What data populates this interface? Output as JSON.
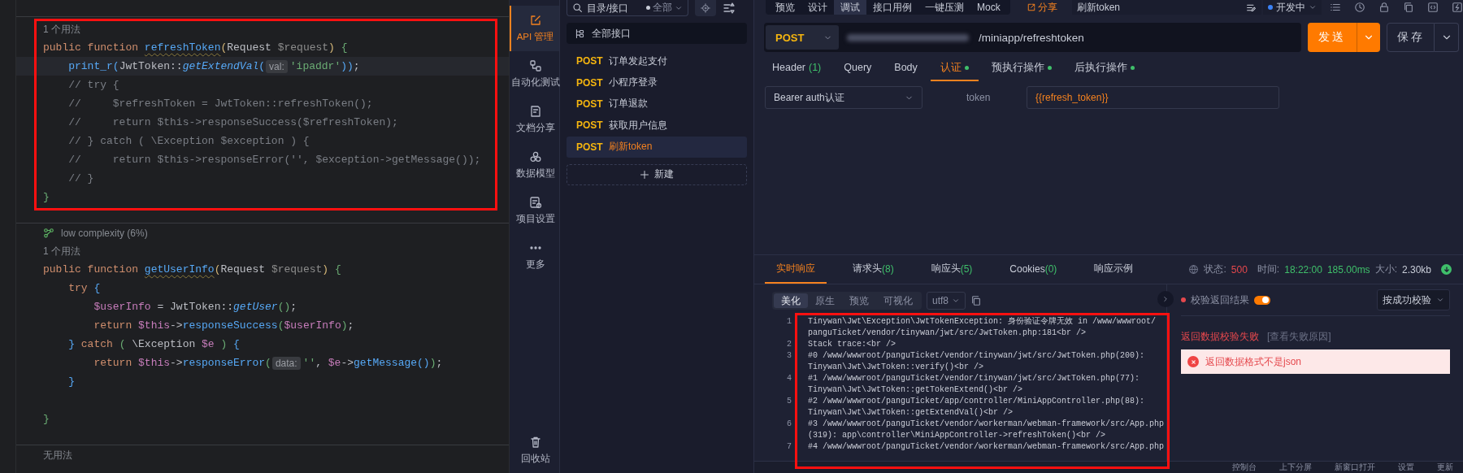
{
  "editor": {
    "highlighted": true,
    "blocks": [
      {
        "usage": "1 个用法",
        "lines": [
          {
            "kind": "code",
            "current": false,
            "tokens": [
              {
                "kind": "kw",
                "text": "public function "
              },
              {
                "kind": "fndef",
                "text": "refreshToken"
              },
              {
                "kind": "paren1",
                "text": "("
              },
              {
                "kind": "plain",
                "text": "Request "
              },
              {
                "kind": "param",
                "text": "$request"
              },
              {
                "kind": "paren1",
                "text": ") "
              },
              {
                "kind": "paren2",
                "text": "{"
              }
            ]
          },
          {
            "kind": "code",
            "current": true,
            "tokens": [
              {
                "kind": "call",
                "text": "    print_r"
              },
              {
                "kind": "paren3",
                "text": "("
              },
              {
                "kind": "plain",
                "text": "JwtToken::"
              },
              {
                "kind": "static",
                "text": "getExtendVal"
              },
              {
                "kind": "paren3",
                "text": "("
              },
              {
                "kind": "hint",
                "text": "val:"
              },
              {
                "kind": "str",
                "text": "'ipaddr'"
              },
              {
                "kind": "paren3",
                "text": "))"
              },
              {
                "kind": "plain",
                "text": ";"
              }
            ]
          },
          {
            "kind": "code",
            "current": false,
            "tokens": [
              {
                "kind": "comment",
                "text": "    // try {"
              }
            ]
          },
          {
            "kind": "code",
            "current": false,
            "tokens": [
              {
                "kind": "comment",
                "text": "    //     $refreshToken = JwtToken::refreshToken();"
              }
            ]
          },
          {
            "kind": "code",
            "current": false,
            "tokens": [
              {
                "kind": "comment",
                "text": "    //     return $this->responseSuccess($refreshToken);"
              }
            ]
          },
          {
            "kind": "code",
            "current": false,
            "tokens": [
              {
                "kind": "comment",
                "text": "    // } catch ( \\Exception $exception ) {"
              }
            ]
          },
          {
            "kind": "code",
            "current": false,
            "tokens": [
              {
                "kind": "comment",
                "text": "    //     return $this->responseError('', $exception->getMessage());"
              }
            ]
          },
          {
            "kind": "code",
            "current": false,
            "tokens": [
              {
                "kind": "comment",
                "text": "    // }"
              }
            ]
          },
          {
            "kind": "code",
            "current": false,
            "tokens": [
              {
                "kind": "paren2",
                "text": "}"
              }
            ]
          }
        ]
      },
      {
        "metric": "low complexity (6%)",
        "usage": "1 个用法",
        "lines": [
          {
            "kind": "code",
            "current": false,
            "tokens": [
              {
                "kind": "kw",
                "text": "public function "
              },
              {
                "kind": "fndef",
                "text": "getUserInfo"
              },
              {
                "kind": "paren1",
                "text": "("
              },
              {
                "kind": "plain",
                "text": "Request "
              },
              {
                "kind": "param",
                "text": "$request"
              },
              {
                "kind": "paren1",
                "text": ") "
              },
              {
                "kind": "paren2",
                "text": "{"
              }
            ]
          },
          {
            "kind": "code",
            "current": false,
            "tokens": [
              {
                "kind": "kw",
                "text": "    try "
              },
              {
                "kind": "paren3",
                "text": "{"
              }
            ]
          },
          {
            "kind": "code",
            "current": false,
            "tokens": [
              {
                "kind": "var",
                "text": "        $userInfo"
              },
              {
                "kind": "plain",
                "text": " = JwtToken::"
              },
              {
                "kind": "static",
                "text": "getUser"
              },
              {
                "kind": "paren2",
                "text": "()"
              },
              {
                "kind": "plain",
                "text": ";"
              }
            ]
          },
          {
            "kind": "code",
            "current": false,
            "tokens": [
              {
                "kind": "kw",
                "text": "        return "
              },
              {
                "kind": "var",
                "text": "$this"
              },
              {
                "kind": "plain",
                "text": "->"
              },
              {
                "kind": "call",
                "text": "responseSuccess"
              },
              {
                "kind": "paren2",
                "text": "("
              },
              {
                "kind": "var",
                "text": "$userInfo"
              },
              {
                "kind": "paren2",
                "text": ")"
              },
              {
                "kind": "plain",
                "text": ";"
              }
            ]
          },
          {
            "kind": "code",
            "current": false,
            "tokens": [
              {
                "kind": "paren3",
                "text": "    }"
              },
              {
                "kind": "kw",
                "text": " catch "
              },
              {
                "kind": "paren2",
                "text": "( "
              },
              {
                "kind": "plain",
                "text": "\\Exception "
              },
              {
                "kind": "var",
                "text": "$e"
              },
              {
                "kind": "paren2",
                "text": " ) "
              },
              {
                "kind": "paren3",
                "text": "{"
              }
            ]
          },
          {
            "kind": "code",
            "current": false,
            "tokens": [
              {
                "kind": "kw",
                "text": "        return "
              },
              {
                "kind": "var",
                "text": "$this"
              },
              {
                "kind": "plain",
                "text": "->"
              },
              {
                "kind": "call",
                "text": "responseError"
              },
              {
                "kind": "paren2",
                "text": "("
              },
              {
                "kind": "hint",
                "text": "data:"
              },
              {
                "kind": "str",
                "text": "''"
              },
              {
                "kind": "plain",
                "text": ", "
              },
              {
                "kind": "var",
                "text": "$e"
              },
              {
                "kind": "plain",
                "text": "->"
              },
              {
                "kind": "call",
                "text": "getMessage"
              },
              {
                "kind": "paren3",
                "text": "()"
              },
              {
                "kind": "paren2",
                "text": ")"
              },
              {
                "kind": "plain",
                "text": ";"
              }
            ]
          },
          {
            "kind": "code",
            "current": false,
            "tokens": [
              {
                "kind": "paren3",
                "text": "    }"
              }
            ]
          },
          {
            "kind": "blank",
            "current": false
          },
          {
            "kind": "code",
            "current": false,
            "tokens": [
              {
                "kind": "paren2",
                "text": "}"
              }
            ]
          }
        ]
      },
      {
        "usage": "无用法"
      }
    ]
  },
  "nav_rail": {
    "items": [
      {
        "kind": "edit",
        "label": "API 管理",
        "selected": true
      },
      {
        "kind": "flow",
        "label": "自动化测试",
        "selected": false
      },
      {
        "kind": "doc",
        "label": "文档分享",
        "selected": false
      },
      {
        "kind": "model",
        "label": "数据模型",
        "selected": false
      },
      {
        "kind": "settings",
        "label": "项目设置",
        "selected": false
      },
      {
        "kind": "more",
        "label": "更多",
        "selected": false
      },
      {
        "kind": "trash",
        "label": "回收站",
        "selected": false
      }
    ]
  },
  "api_list": {
    "search": {
      "placeholder": "目录/接口"
    },
    "filter": "全部",
    "root": "全部接口",
    "new_button": "新建",
    "items": [
      {
        "method": "POST",
        "name": "订单发起支付",
        "selected": false
      },
      {
        "method": "POST",
        "name": "小程序登录",
        "selected": false
      },
      {
        "method": "POST",
        "name": "订单退款",
        "selected": false
      },
      {
        "method": "POST",
        "name": "获取用户信息",
        "selected": false
      },
      {
        "method": "POST",
        "name": "刷新token",
        "selected": true
      }
    ]
  },
  "workbench": {
    "highlighted": true,
    "mode_tabs": [
      {
        "label": "预览",
        "selected": false
      },
      {
        "label": "设计",
        "selected": false
      },
      {
        "label": "调试",
        "selected": true
      },
      {
        "label": "接口用例",
        "selected": false
      },
      {
        "label": "一键压测",
        "selected": false
      },
      {
        "label": "Mock",
        "selected": false
      }
    ],
    "share": "分享",
    "title": "刷新token",
    "environment": "开发中",
    "request": {
      "method": "POST",
      "path": "/miniapp/refreshtoken",
      "send": "发送",
      "save": "保存"
    },
    "request_tabs": [
      {
        "label": "Header",
        "count": "(1)",
        "dot": false,
        "selected": false
      },
      {
        "label": "Query",
        "dot": false,
        "selected": false
      },
      {
        "label": "Body",
        "dot": false,
        "selected": false
      },
      {
        "label": "认证",
        "dot": true,
        "selected": true
      },
      {
        "label": "预执行操作",
        "dot": true,
        "selected": false
      },
      {
        "label": "后执行操作",
        "dot": true,
        "selected": false
      }
    ],
    "auth": {
      "type": "Bearer auth认证",
      "field_label": "token",
      "value": "{{refresh_token}}"
    },
    "response_tabs": [
      {
        "label": "实时响应",
        "selected": true
      },
      {
        "label": "请求头",
        "count": "(8)",
        "selected": false
      },
      {
        "label": "响应头",
        "count": "(5)",
        "selected": false
      },
      {
        "label": "Cookies",
        "count": "(0)",
        "selected": false
      },
      {
        "label": "响应示例",
        "selected": false
      }
    ],
    "stats": {
      "status_label": "状态:",
      "status": "500",
      "time_label": "时间:",
      "time": "18:22:00",
      "duration": "185.00ms",
      "size_label": "大小:",
      "size": "2.30kb"
    },
    "view_tabs": [
      {
        "label": "美化",
        "selected": true
      },
      {
        "label": "原生",
        "selected": false
      },
      {
        "label": "预览",
        "selected": false
      },
      {
        "label": "可视化",
        "selected": false
      }
    ],
    "encoding": "utf8",
    "body_lines": [
      {
        "number": "1",
        "rows": [
          "Tinywan\\Jwt\\Exception\\JwtTokenException: 身份验证令牌无效 in /www/wwwroot/",
          "panguTicket/vendor/tinywan/jwt/src/JwtToken.php:181<br />"
        ]
      },
      {
        "number": "2",
        "rows": [
          "Stack trace:<br />"
        ]
      },
      {
        "number": "3",
        "rows": [
          "#0 /www/wwwroot/panguTicket/vendor/tinywan/jwt/src/JwtToken.php(200):",
          "Tinywan\\Jwt\\JwtToken::verify()<br />"
        ]
      },
      {
        "number": "4",
        "rows": [
          "#1 /www/wwwroot/panguTicket/vendor/tinywan/jwt/src/JwtToken.php(77):",
          "Tinywan\\Jwt\\JwtToken::getTokenExtend()<br />"
        ]
      },
      {
        "number": "5",
        "rows": [
          "#2 /www/wwwroot/panguTicket/app/controller/MiniAppController.php(88):",
          "Tinywan\\Jwt\\JwtToken::getExtendVal()<br />"
        ]
      },
      {
        "number": "6",
        "rows": [
          "#3 /www/wwwroot/panguTicket/vendor/workerman/webman-framework/src/App.php",
          "(319): app\\controller\\MiniAppController->refreshToken()<br />"
        ]
      },
      {
        "number": "7",
        "rows": [
          "#4 /www/wwwroot/panguTicket/vendor/workerman/webman-framework/src/App.php"
        ]
      }
    ],
    "validation": {
      "label": "校验返回结果",
      "on": true,
      "mode": "按成功校验",
      "result": "返回数据校验失败",
      "link": "[查看失败原因]",
      "error": "返回数据格式不是json"
    },
    "bottom_bar": [
      "控制台",
      "上下分屏",
      "新窗口打开",
      "设置",
      "更新"
    ]
  }
}
